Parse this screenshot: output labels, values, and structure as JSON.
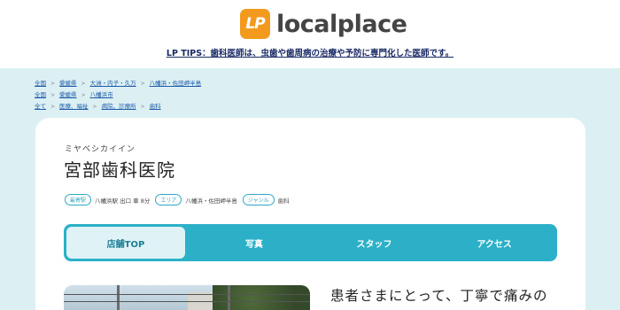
{
  "header": {
    "logo_mark": "LP",
    "logo_text": "localplace",
    "tips": "LP TIPS：歯科医師は、虫歯や歯周病の治療や予防に専門化した医師です。"
  },
  "breadcrumbs": [
    [
      "全国",
      "愛媛県",
      "大洲・内子・久万",
      "八幡浜・佐田岬半島"
    ],
    [
      "全国",
      "愛媛県",
      "八幡浜市"
    ],
    [
      "全て",
      "医療、福祉",
      "病院、診療所",
      "歯科"
    ]
  ],
  "clinic": {
    "kana": "ミヤベシカイイン",
    "name": "宮部歯科医院",
    "meta": {
      "station_tag": "最寄駅",
      "station_value": "八幡浜駅 出口 車 8分",
      "area_tag": "エリア",
      "area_value": "八幡浜・佐田岬半島",
      "genre_tag": "ジャンル",
      "genre_value": "歯科"
    }
  },
  "tabs": [
    "店舗TOP",
    "写真",
    "スタッフ",
    "アクセス"
  ],
  "active_tab": 0,
  "lead_text": "患者さまにとって、丁寧で痛みの",
  "colors": {
    "accent": "#2bb0c8",
    "logo": "#f39a1e",
    "background": "#dcf0f4"
  }
}
